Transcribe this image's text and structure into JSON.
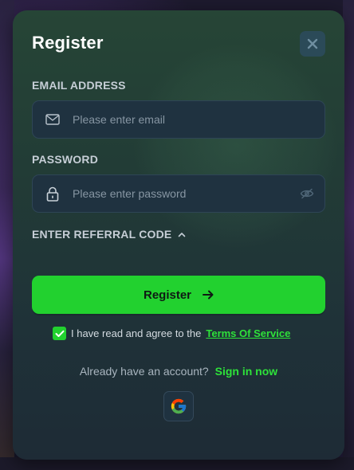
{
  "modal": {
    "title": "Register"
  },
  "email": {
    "label": "EMAIL ADDRESS",
    "placeholder": "Please enter email",
    "value": ""
  },
  "password": {
    "label": "PASSWORD",
    "placeholder": "Please enter password",
    "value": ""
  },
  "referral": {
    "label": "ENTER REFERRAL CODE",
    "expanded": true
  },
  "register_button": {
    "label": "Register"
  },
  "terms": {
    "checked": true,
    "text": "I have read and agree to the",
    "link": "Terms Of Service"
  },
  "signin": {
    "text": "Already have an account?",
    "link": "Sign in now"
  },
  "colors": {
    "accent_green": "#22d12f",
    "link_green": "#2ee23a",
    "modal_bg": "#223c36",
    "input_bg": "#1f3240",
    "close_bg": "#2b4a58"
  },
  "icons": {
    "close": "close-icon",
    "email": "mail-icon",
    "password": "lock-icon",
    "visibility": "eye-off-icon",
    "referral_toggle": "chevron-up-icon",
    "register_arrow": "arrow-right-icon",
    "checkbox": "check-icon",
    "google": "google-icon"
  }
}
